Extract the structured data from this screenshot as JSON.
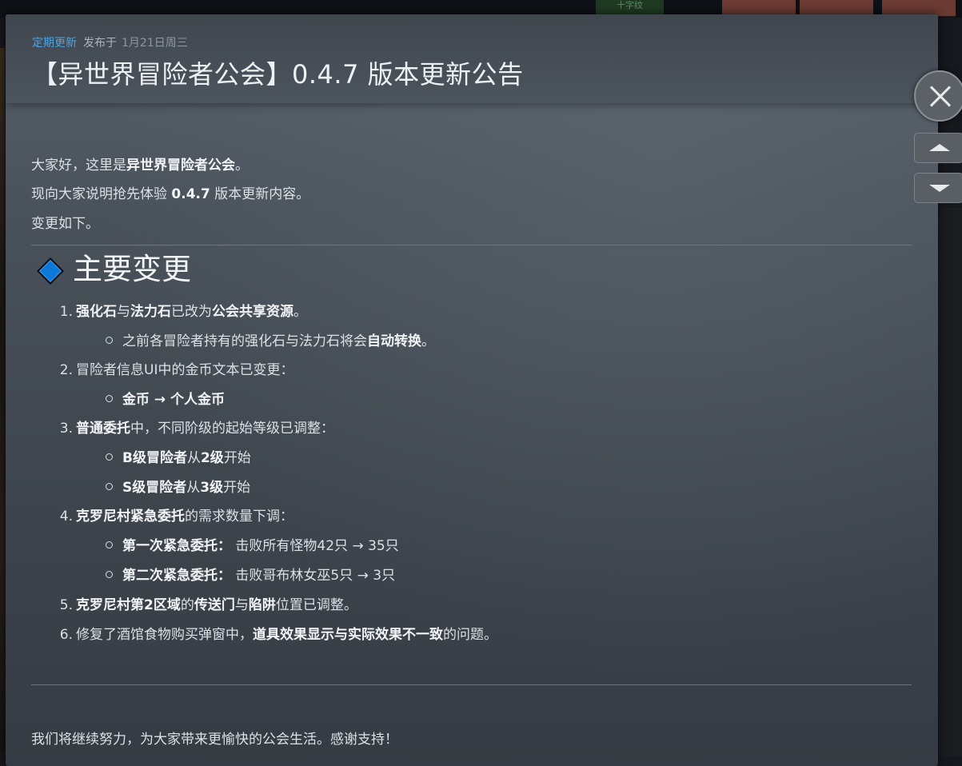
{
  "header": {
    "category": "定期更新",
    "posted_label": "发布于",
    "date": "1月21日周三",
    "title": "【异世界冒险者公会】0.4.7 版本更新公告"
  },
  "intro": {
    "line1_prefix": "大家好，这里是",
    "line1_bold": "异世界冒险者公会",
    "line1_suffix": "。",
    "line2_prefix": "现向大家说明抢先体验 ",
    "line2_bold": "0.4.7",
    "line2_suffix": " 版本更新内容。",
    "line3": "变更如下。"
  },
  "section": {
    "heading": "主要变更"
  },
  "items": [
    {
      "num": "1.",
      "a_b": "强化石",
      "b": "与",
      "c_b": "法力石",
      "d": "已改为",
      "e_b": "公会共享资源",
      "f": "。"
    },
    {
      "sub_prefix": "之前各冒险者持有的强化石与法力石将会",
      "sub_bold": "自动转换",
      "sub_suffix": "。"
    },
    {
      "num": "2.",
      "text": "冒险者信息UI中的金币文本已变更："
    },
    {
      "sub_bold": "金币 → 个人金币"
    },
    {
      "num": "3.",
      "a_b": "普通委托",
      "b": "中，不同阶级的起始等级已调整："
    },
    {
      "a_b": "B级冒险者",
      "b": "从",
      "c_b": "2级",
      "d": "开始"
    },
    {
      "a_b": "S级冒险者",
      "b": "从",
      "c_b": "3级",
      "d": "开始"
    },
    {
      "num": "4.",
      "a_b": "克罗尼村紧急委托",
      "b": "的需求数量下调："
    },
    {
      "a_b": "第一次紧急委托：",
      "b": " 击败所有怪物42只 → 35只"
    },
    {
      "a_b": "第二次紧急委托：",
      "b": " 击败哥布林女巫5只 → 3只"
    },
    {
      "num": "5.",
      "a_b": "克罗尼村第2区域",
      "b": "的",
      "c_b": "传送门",
      "d": "与",
      "e_b": "陷阱",
      "f": "位置已调整。"
    },
    {
      "num": "6.",
      "a": "修复了酒馆食物购买弹窗中，",
      "b_b": "道具效果显示与实际效果不一致",
      "c": "的问题。"
    }
  ],
  "closing": "我们将继续努力，为大家带来更愉快的公会生活。感谢支持！",
  "background": {
    "tab_label": "十字纹"
  },
  "colors": {
    "accent": "#4da3e6",
    "diamond": "#0c78d8"
  }
}
